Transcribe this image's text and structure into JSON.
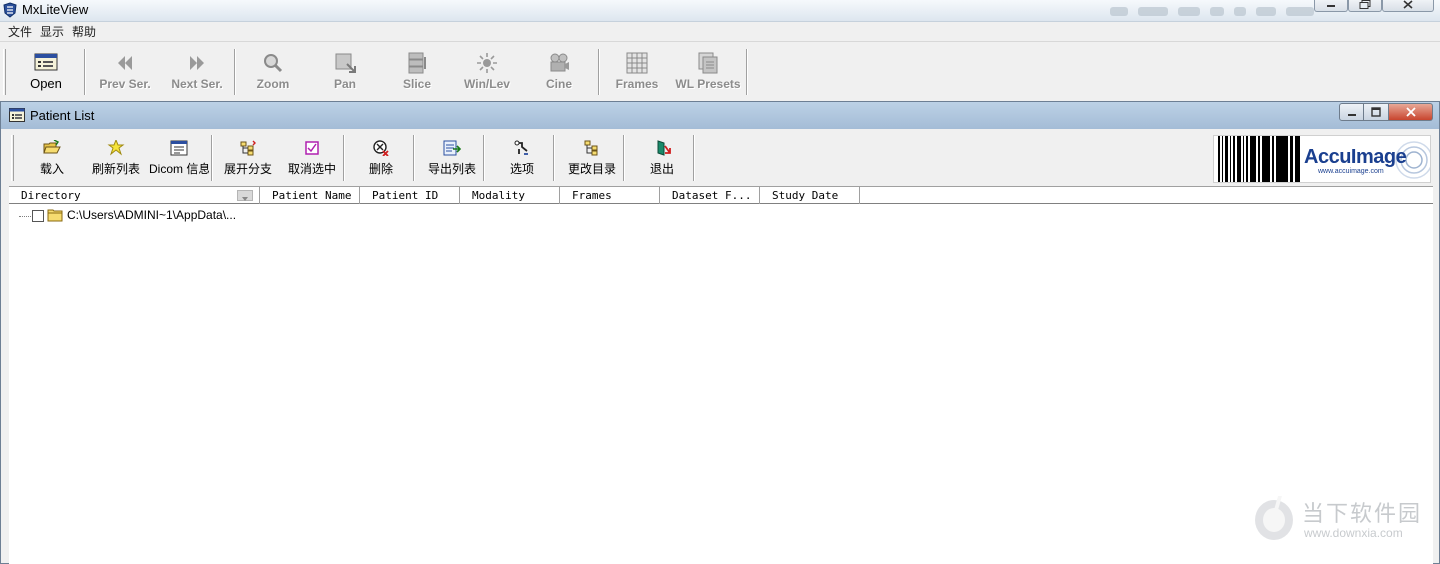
{
  "app": {
    "title": "MxLiteView"
  },
  "menu": {
    "items": [
      "文件",
      "显示",
      "帮助"
    ]
  },
  "main_toolbar": {
    "buttons": [
      {
        "label": "Open",
        "icon": "open-monitor-icon",
        "enabled": true
      },
      {
        "label": "Prev Ser.",
        "icon": "prev-series-icon",
        "enabled": false
      },
      {
        "label": "Next Ser.",
        "icon": "next-series-icon",
        "enabled": false
      },
      {
        "label": "Zoom",
        "icon": "zoom-icon",
        "enabled": false
      },
      {
        "label": "Pan",
        "icon": "pan-icon",
        "enabled": false
      },
      {
        "label": "Slice",
        "icon": "slice-icon",
        "enabled": false
      },
      {
        "label": "Win/Lev",
        "icon": "window-level-icon",
        "enabled": false
      },
      {
        "label": "Cine",
        "icon": "cine-icon",
        "enabled": false
      },
      {
        "label": "Frames",
        "icon": "frames-grid-icon",
        "enabled": false
      },
      {
        "label": "WL Presets",
        "icon": "wl-presets-icon",
        "enabled": false
      }
    ]
  },
  "patient_window": {
    "title": "Patient List",
    "toolbar": {
      "buttons": [
        {
          "label": "载入",
          "icon": "folder-open-icon"
        },
        {
          "label": "刷新列表",
          "icon": "star-refresh-icon"
        },
        {
          "label": "Dicom 信息",
          "icon": "dicom-info-icon"
        },
        {
          "label": "展开分支",
          "icon": "expand-branch-icon"
        },
        {
          "label": "取消选中",
          "icon": "uncheck-icon"
        },
        {
          "label": "删除",
          "icon": "delete-icon"
        },
        {
          "label": "导出列表",
          "icon": "export-list-icon"
        },
        {
          "label": "选项",
          "icon": "options-icon"
        },
        {
          "label": "更改目录",
          "icon": "change-directory-icon"
        },
        {
          "label": "退出",
          "icon": "exit-icon"
        }
      ]
    },
    "logo": {
      "text": "AccuImage",
      "url": "www.accuimage.com",
      "accent": "#1a3f8f"
    },
    "columns": [
      "Directory",
      "Patient Name",
      "Patient ID",
      "Modality",
      "Frames",
      "Dataset F...",
      "Study Date"
    ],
    "tree": [
      {
        "label": "C:\\Users\\ADMINI~1\\AppData\\...",
        "checked": false,
        "icon": "folder-icon"
      }
    ]
  },
  "watermark": {
    "text": "当下软件园",
    "url": "www.downxia.com"
  }
}
